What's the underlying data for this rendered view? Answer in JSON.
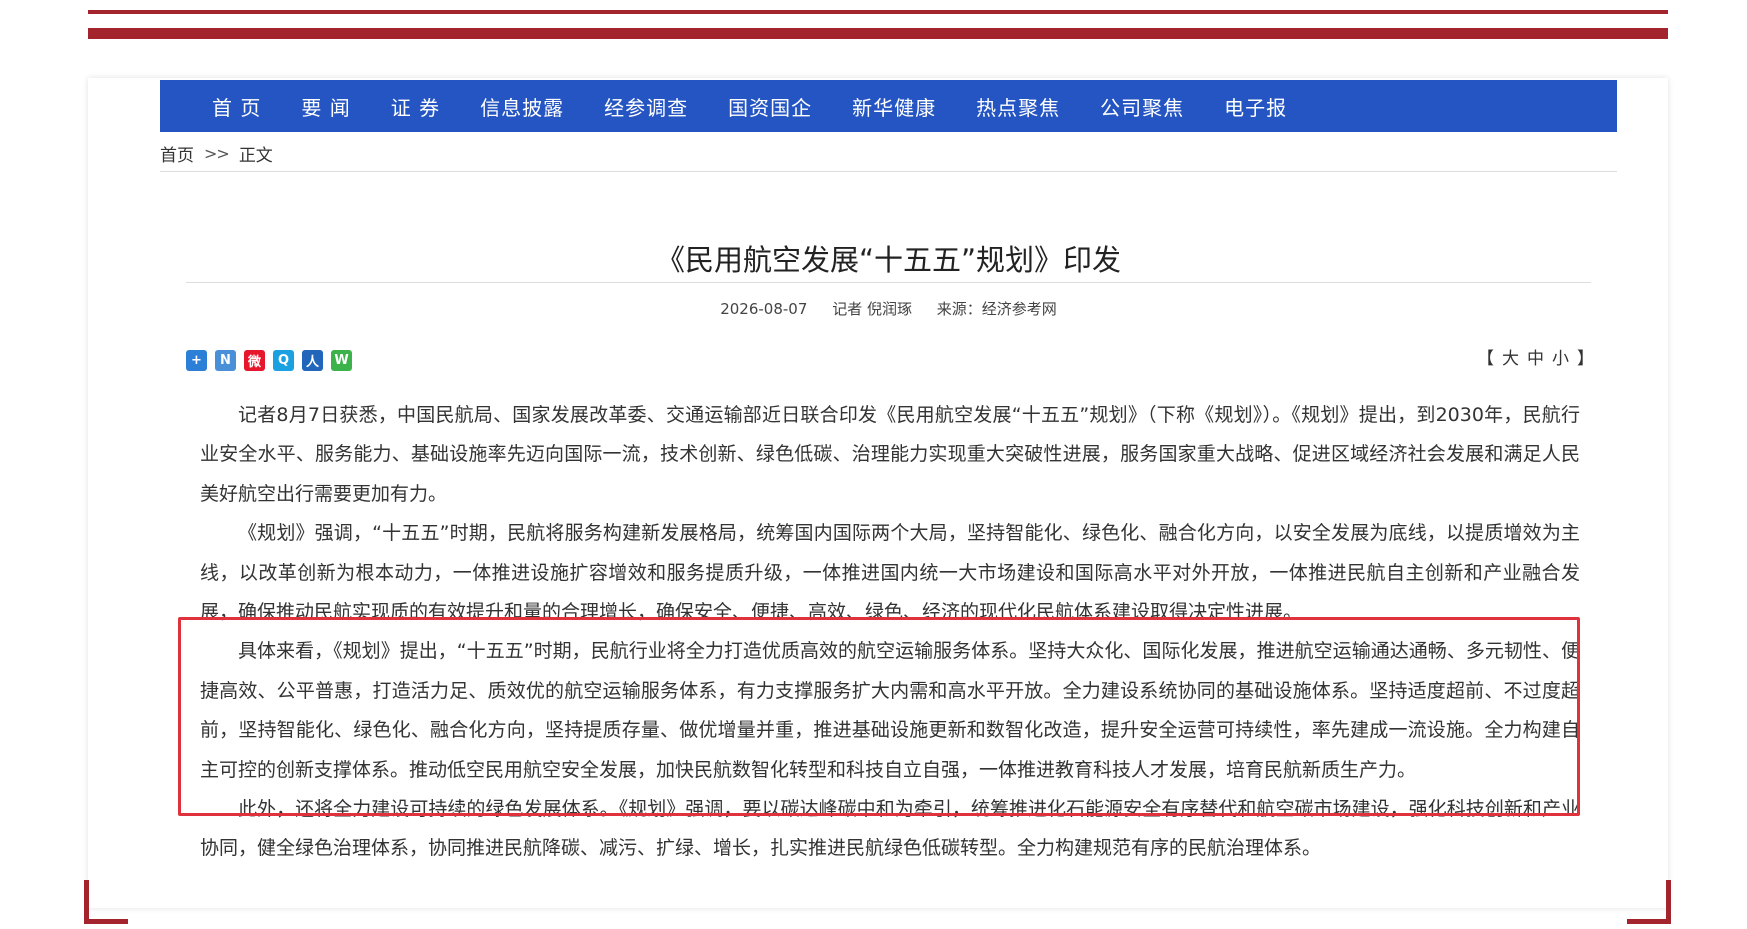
{
  "nav": {
    "items": [
      "首 页",
      "要 闻",
      "证 券",
      "信息披露",
      "经参调查",
      "国资国企",
      "新华健康",
      "热点聚焦",
      "公司聚焦",
      "电子报"
    ]
  },
  "breadcrumb": {
    "home": "首页",
    "separator": ">>",
    "current": "正文"
  },
  "article": {
    "title": "《民用航空发展“十五五”规划》印发",
    "date": "2026-08-07",
    "reporter": "记者 倪润琢",
    "source": "来源：经济参考网",
    "paragraphs": [
      "记者8月7日获悉，中国民航局、国家发展改革委、交通运输部近日联合印发《民用航空发展“十五五”规划》（下称《规划》）。《规划》提出，到2030年，民航行业安全水平、服务能力、基础设施率先迈向国际一流，技术创新、绿色低碳、治理能力实现重大突破性进展，服务国家重大战略、促进区域经济社会发展和满足人民美好航空出行需要更加有力。",
      "《规划》强调，“十五五”时期，民航将服务构建新发展格局，统筹国内国际两个大局，坚持智能化、绿色化、融合化方向，以安全发展为底线，以提质增效为主线，以改革创新为根本动力，一体推进设施扩容增效和服务提质升级，一体推进国内统一大市场建设和国际高水平对外开放，一体推进民航自主创新和产业融合发展，确保推动民航实现质的有效提升和量的合理增长，确保安全、便捷、高效、绿色、经济的现代化民航体系建设取得决定性进展。",
      "具体来看，《规划》提出，“十五五”时期，民航行业将全力打造优质高效的航空运输服务体系。坚持大众化、国际化发展，推进航空运输通达通畅、多元韧性、便捷高效、公平普惠，打造活力足、质效优的航空运输服务体系，有力支撑服务扩大内需和高水平开放。全力建设系统协同的基础设施体系。坚持适度超前、不过度超前，坚持智能化、绿色化、融合化方向，坚持提质存量、做优增量并重，推进基础设施更新和数智化改造，提升安全运营可持续性，率先建成一流设施。全力构建自主可控的创新支撑体系。推动低空民用航空安全发展，加快民航数智化转型和科技自立自强，一体推进教育科技人才发展，培育民航新质生产力。",
      "此外，还将全力建设可持续的绿色发展体系。《规划》强调，要以碳达峰碳中和为牵引，统筹推进化石能源安全有序替代和航空碳市场建设，强化科技创新和产业协同，健全绿色治理体系，协同推进民航降碳、减污、扩绿、增长，扎实推进民航绿色低碳转型。全力构建规范有序的民航治理体系。"
    ]
  },
  "font_size": {
    "open": "【",
    "large": "大",
    "medium": "中",
    "small": "小",
    "close": "】"
  },
  "share": {
    "icons": [
      {
        "name": "plus-share-icon",
        "glyph": "+",
        "color": "#2b7fd6"
      },
      {
        "name": "netease-share-icon",
        "glyph": "N",
        "color": "#4a90d9"
      },
      {
        "name": "weibo-share-icon",
        "glyph": "微",
        "color": "#e6162d"
      },
      {
        "name": "tencent-share-icon",
        "glyph": "Q",
        "color": "#1ba1e2"
      },
      {
        "name": "renren-share-icon",
        "glyph": "人",
        "color": "#2266bb"
      },
      {
        "name": "wechat-share-icon",
        "glyph": "W",
        "color": "#3bb34a"
      }
    ]
  },
  "colors": {
    "brand_red": "#a3242c",
    "nav_blue": "#2455c2",
    "highlight_red": "#e0323c"
  }
}
